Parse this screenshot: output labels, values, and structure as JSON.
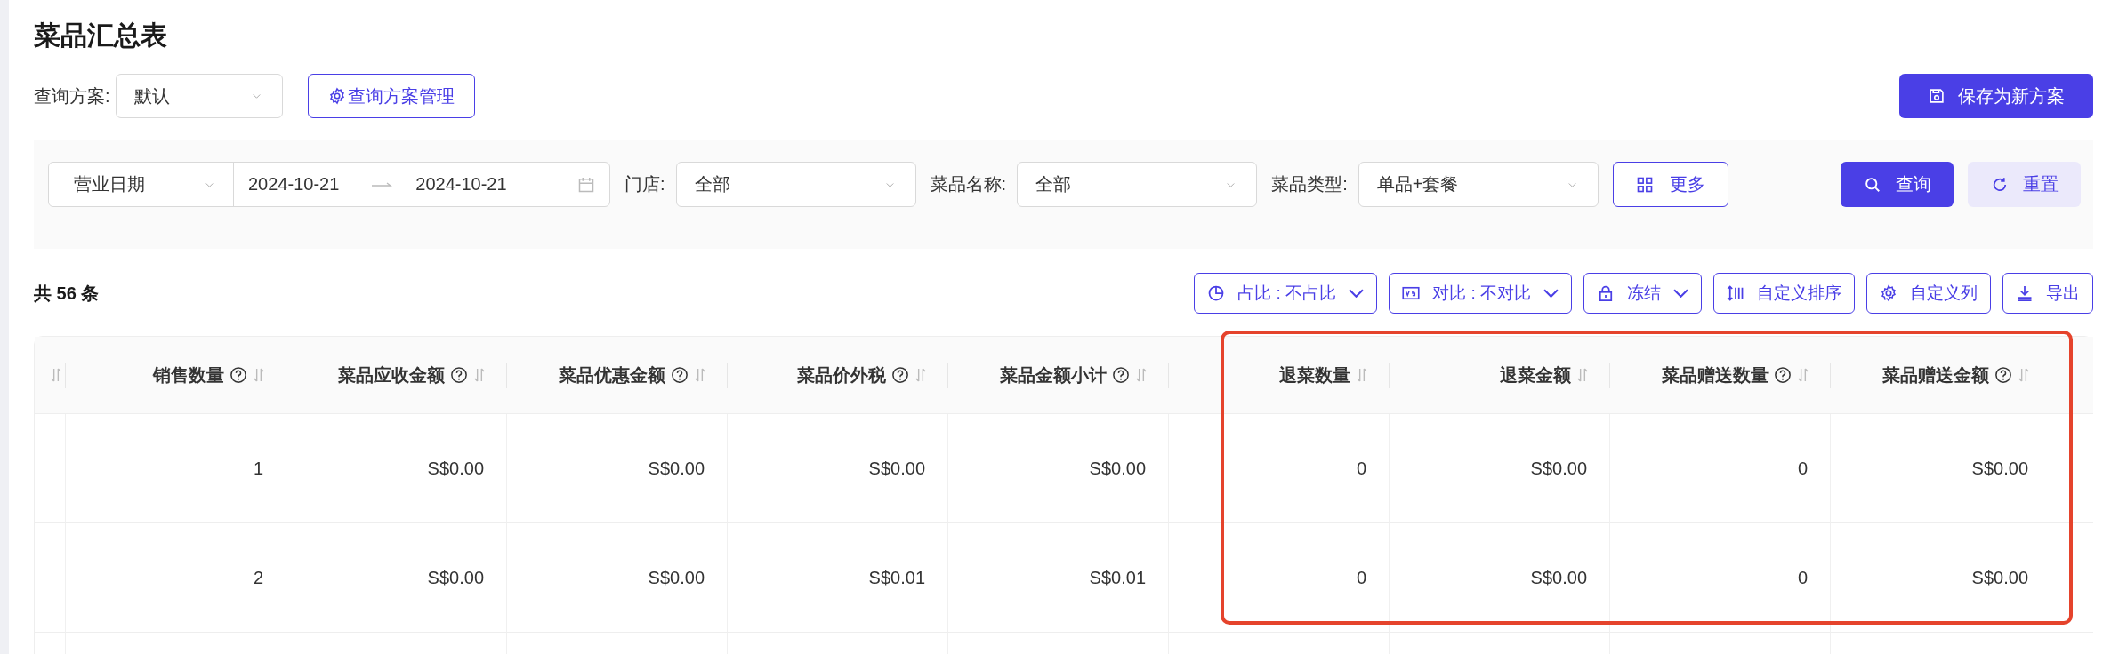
{
  "title": "菜品汇总表",
  "scheme": {
    "label": "查询方案:",
    "value": "默认",
    "manage_button": "查询方案管理",
    "save_button": "保存为新方案"
  },
  "filters": {
    "date_type": "营业日期",
    "date_start": "2024-10-21",
    "date_end": "2024-10-21",
    "fields": [
      {
        "label": "门店:",
        "value": "全部"
      },
      {
        "label": "菜品名称:",
        "value": "全部"
      },
      {
        "label": "菜品类型:",
        "value": "单品+套餐"
      }
    ],
    "more_button": "更多",
    "search_button": "查询",
    "reset_button": "重置"
  },
  "total": "共 56 条",
  "toolbar": [
    {
      "kind": "ratio",
      "label": "占比 : 不占比",
      "dropdown": true
    },
    {
      "kind": "compare",
      "label": "对比 : 不对比",
      "dropdown": true
    },
    {
      "kind": "freeze",
      "label": "冻结",
      "dropdown": true
    },
    {
      "kind": "sort",
      "label": "自定义排序",
      "dropdown": false
    },
    {
      "kind": "columns",
      "label": "自定义列",
      "dropdown": false
    },
    {
      "kind": "export",
      "label": "导出",
      "dropdown": false
    }
  ],
  "table": {
    "columns": [
      {
        "label": "销售数量",
        "help": true
      },
      {
        "label": "菜品应收金额",
        "help": true
      },
      {
        "label": "菜品优惠金额",
        "help": true
      },
      {
        "label": "菜品价外税",
        "help": true
      },
      {
        "label": "菜品金额小计",
        "help": true
      },
      {
        "label": "退菜数量",
        "help": false
      },
      {
        "label": "退菜金额",
        "help": false
      },
      {
        "label": "菜品赠送数量",
        "help": true
      },
      {
        "label": "菜品赠送金额",
        "help": true
      }
    ],
    "rows": [
      {
        "cells": [
          "1",
          "S$0.00",
          "S$0.00",
          "S$0.00",
          "S$0.00",
          "0",
          "S$0.00",
          "0",
          "S$0.00"
        ]
      },
      {
        "cells": [
          "2",
          "S$0.00",
          "S$0.00",
          "S$0.01",
          "S$0.01",
          "0",
          "S$0.00",
          "0",
          "S$0.00"
        ]
      }
    ]
  },
  "annotation": {
    "kind": "frame"
  }
}
